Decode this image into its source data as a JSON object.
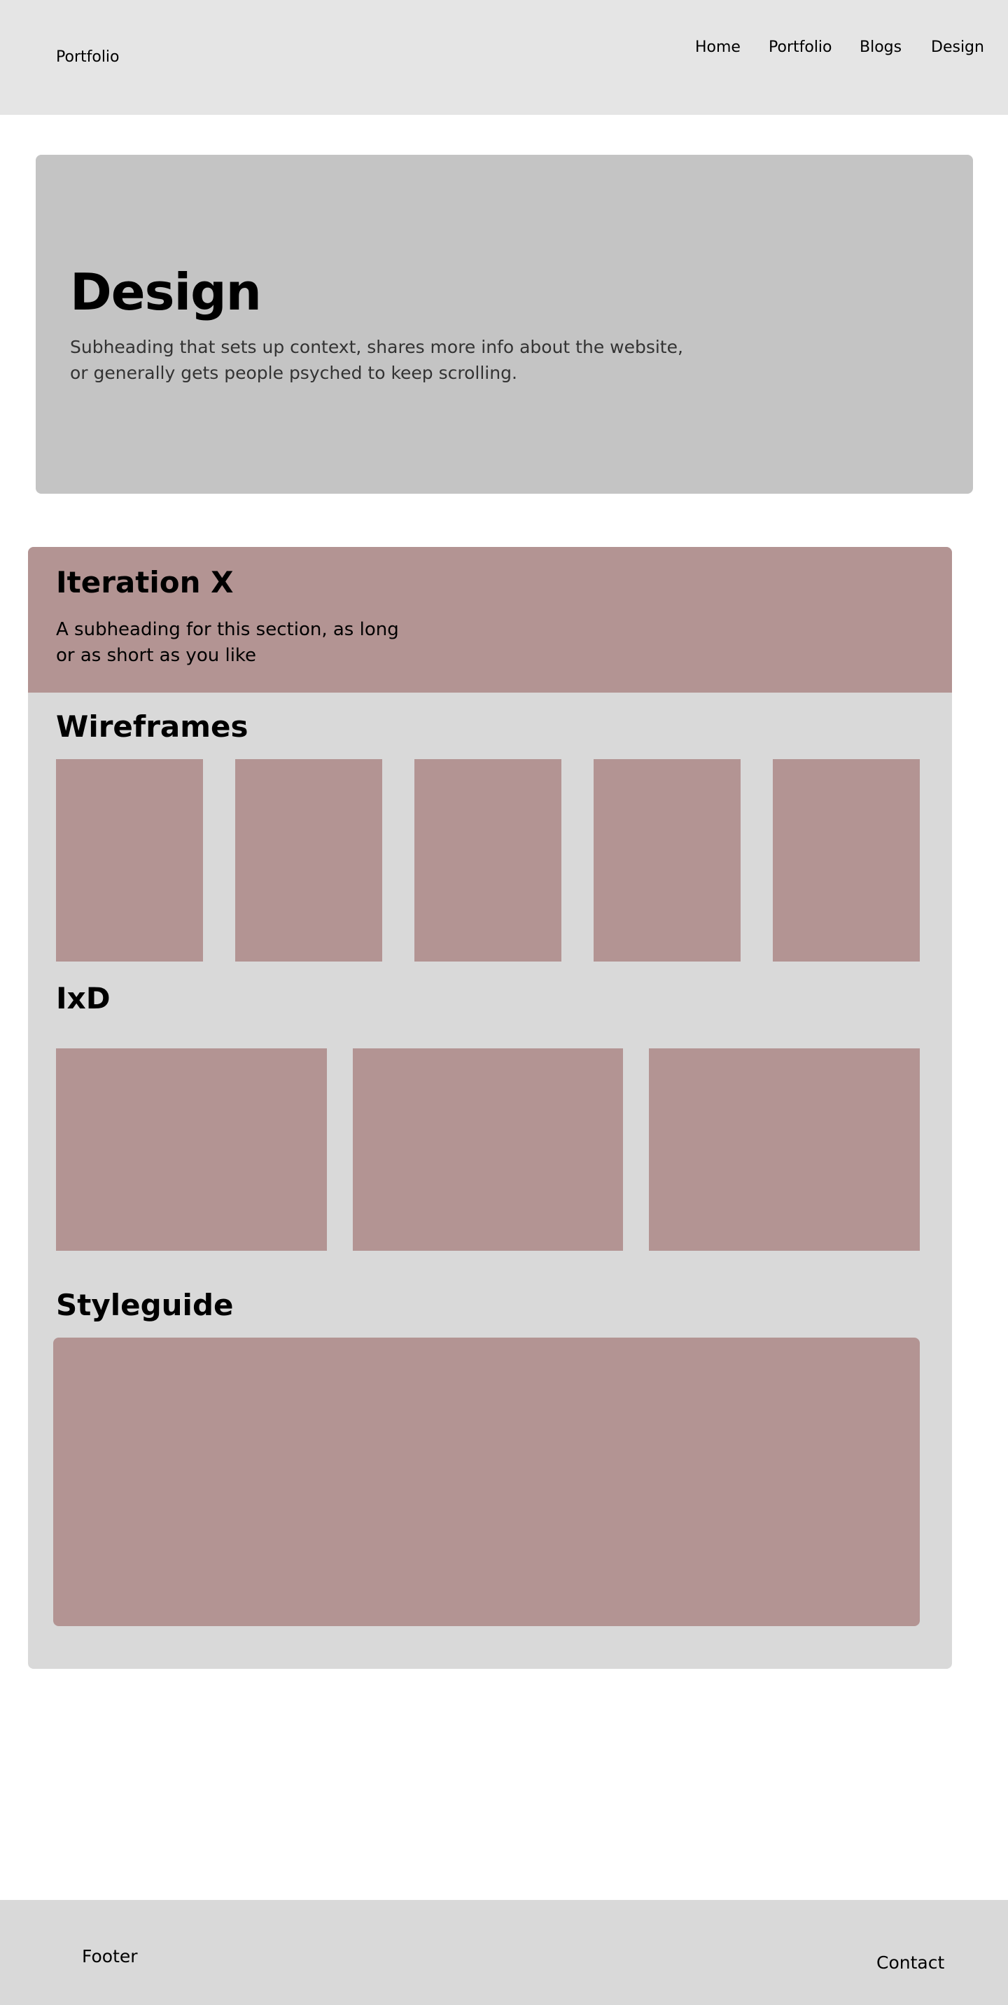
{
  "header": {
    "brand": "Portfolio",
    "nav": [
      "Home",
      "Portfolio",
      "Blogs",
      "Design"
    ]
  },
  "hero": {
    "title": "Design",
    "subtitle": "Subheading that sets up context, shares more info about the website, or generally gets people psyched to keep scrolling."
  },
  "iteration": {
    "title": "Iteration X",
    "subtitle": "A subheading for this section, as long or as short as you like",
    "sections": {
      "wireframes": "Wireframes",
      "ixd": "IxD",
      "styleguide": "Styleguide"
    }
  },
  "footer": {
    "label": "Footer",
    "contact": "Contact"
  },
  "colors": {
    "header_bg": "#e5e5e5",
    "hero_bg": "#c4c4c4",
    "section_bg": "#d9d9d9",
    "accent": "#b39493"
  }
}
